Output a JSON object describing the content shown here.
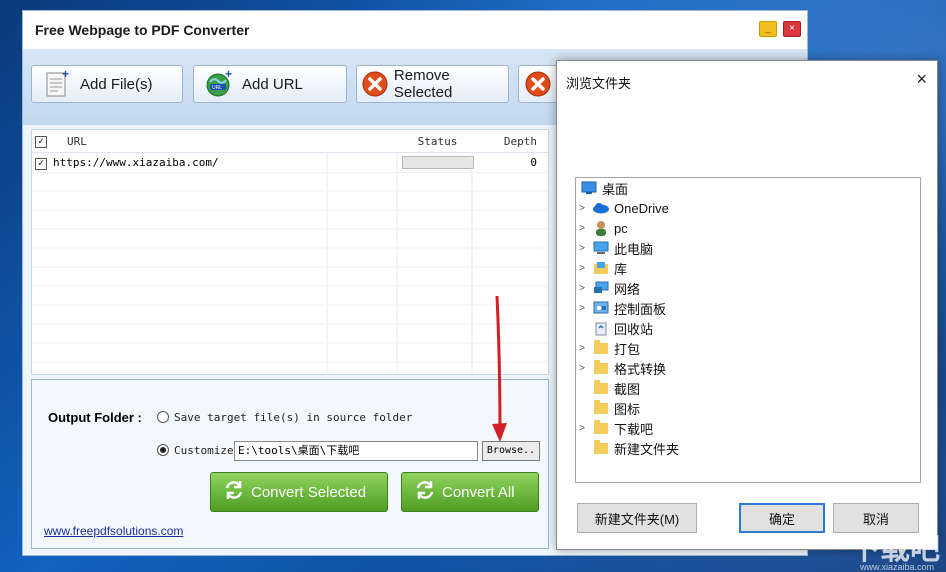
{
  "app": {
    "title": "Free Webpage to PDF Converter",
    "minimize_label": "_",
    "close_label": "×"
  },
  "toolbar": {
    "add_files": "Add File(s)",
    "add_url": "Add URL",
    "remove_selected": "Remove Selected"
  },
  "table": {
    "headers": {
      "url": "URL",
      "status": "Status",
      "depth": "Depth"
    },
    "rows": [
      {
        "url": "https://www.xiazaiba.com/",
        "status_progress": 0,
        "depth": "0",
        "checked": true
      }
    ]
  },
  "output": {
    "label": "Output Folder :",
    "option_source": "Save target file(s) in source folder",
    "option_customize": "Customize",
    "path": "E:\\tools\\桌面\\下载吧",
    "browse": "Browse..",
    "selected_option": "customize"
  },
  "actions": {
    "convert_selected": "Convert Selected",
    "convert_all": "Convert All",
    "website": "www.freepdfsolutions.com"
  },
  "dialog": {
    "title": "浏览文件夹",
    "close": "×",
    "tree": [
      {
        "label": "桌面",
        "icon": "desktop-icon",
        "expandable": false,
        "root": true
      },
      {
        "label": "OneDrive",
        "icon": "cloud-icon",
        "expandable": true
      },
      {
        "label": "pc",
        "icon": "user-icon",
        "expandable": true
      },
      {
        "label": "此电脑",
        "icon": "computer-icon",
        "expandable": true
      },
      {
        "label": "库",
        "icon": "library-icon",
        "expandable": true
      },
      {
        "label": "网络",
        "icon": "network-icon",
        "expandable": true
      },
      {
        "label": "控制面板",
        "icon": "control-panel-icon",
        "expandable": true
      },
      {
        "label": "回收站",
        "icon": "recycle-bin-icon",
        "expandable": false
      },
      {
        "label": "打包",
        "icon": "folder-icon",
        "expandable": true
      },
      {
        "label": "格式转换",
        "icon": "folder-icon",
        "expandable": true
      },
      {
        "label": "截图",
        "icon": "folder-icon",
        "expandable": false
      },
      {
        "label": "图标",
        "icon": "folder-icon",
        "expandable": false
      },
      {
        "label": "下载吧",
        "icon": "folder-icon",
        "expandable": true
      },
      {
        "label": "新建文件夹",
        "icon": "folder-icon",
        "expandable": false
      }
    ],
    "new_folder": "新建文件夹(M)",
    "ok": "确定",
    "cancel": "取消"
  },
  "watermark": {
    "text": "下载吧",
    "sub": "www.xiazaiba.com"
  },
  "colors": {
    "accent_green": "#4e9e23",
    "remove_red": "#e24b1b",
    "link_blue": "#1a2f9a",
    "arrow_red": "#d21f26"
  }
}
